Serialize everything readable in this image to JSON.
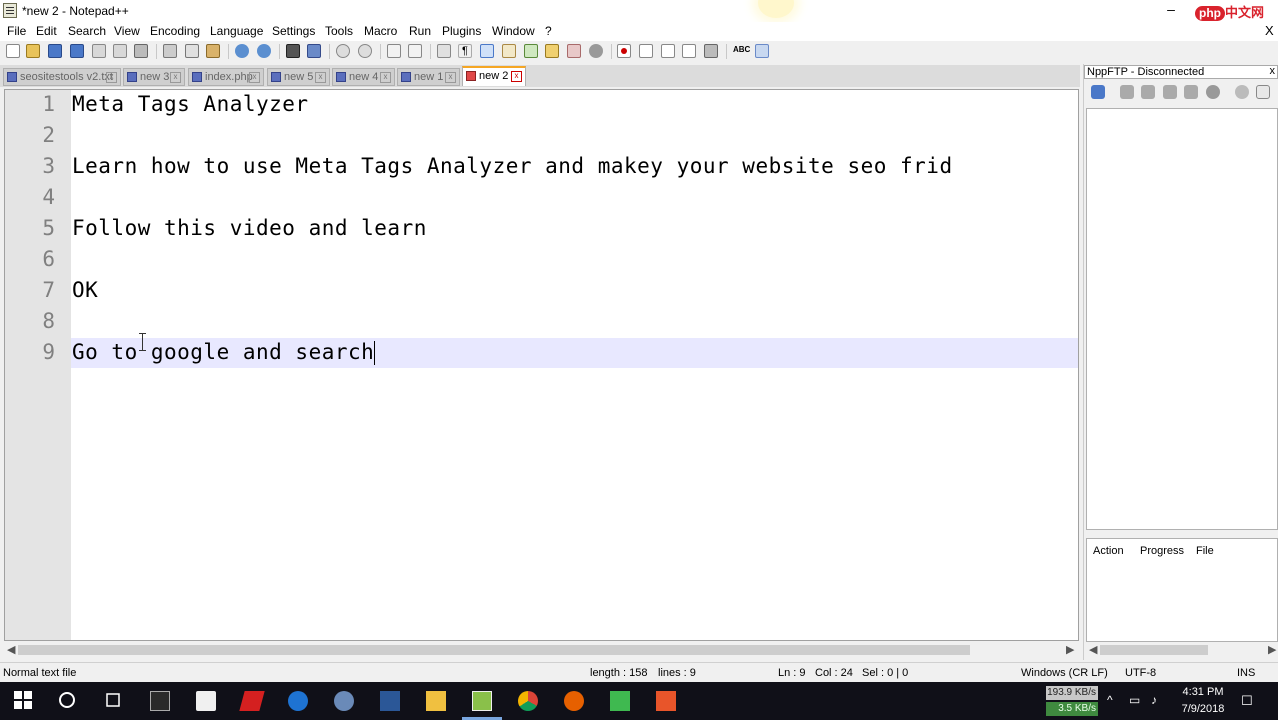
{
  "window": {
    "title": "*new 2 - Notepad++",
    "minimize_glyph": "–",
    "overlay_logo": {
      "badge": "php",
      "text": "中文网"
    }
  },
  "menu": {
    "items": [
      "File",
      "Edit",
      "Search",
      "View",
      "Encoding",
      "Language",
      "Settings",
      "Tools",
      "Macro",
      "Run",
      "Plugins",
      "Window",
      "?"
    ],
    "close_glyph": "X"
  },
  "toolbar": {
    "icons": [
      "new-file-icon",
      "open-icon",
      "save-icon",
      "save-all-icon",
      "close-icon",
      "close-all-icon",
      "print-icon",
      "cut-icon",
      "copy-icon",
      "paste-icon",
      "undo-icon",
      "redo-icon",
      "find-icon",
      "replace-icon",
      "zoom-in-icon",
      "zoom-out-icon",
      "sync-v-icon",
      "sync-h-icon",
      "word-wrap-icon",
      "show-all-chars-icon",
      "indent-guide-icon",
      "doc-map-icon",
      "function-list-icon",
      "folder-workspace-icon",
      "monitor-icon",
      "record-macro-icon",
      "stop-macro-icon",
      "play-macro-icon",
      "run-macro-multiple-icon",
      "save-macro-icon",
      "spellcheck-icon",
      "ftp-icon"
    ]
  },
  "tabs": [
    {
      "label": "seositestools v2.txt",
      "active": false
    },
    {
      "label": "new 3",
      "active": false
    },
    {
      "label": "index.php",
      "active": false
    },
    {
      "label": "new 5",
      "active": false
    },
    {
      "label": "new 4",
      "active": false
    },
    {
      "label": "new 1",
      "active": false
    },
    {
      "label": "new 2",
      "active": true
    }
  ],
  "editor": {
    "lines": [
      {
        "num": "1",
        "text": "Meta Tags Analyzer"
      },
      {
        "num": "2",
        "text": ""
      },
      {
        "num": "3",
        "text": "Learn how to use Meta Tags Analyzer and makey your website seo frid"
      },
      {
        "num": "4",
        "text": ""
      },
      {
        "num": "5",
        "text": "Follow this video and learn"
      },
      {
        "num": "6",
        "text": ""
      },
      {
        "num": "7",
        "text": "OK"
      },
      {
        "num": "8",
        "text": ""
      },
      {
        "num": "9",
        "text": "Go to google and search"
      }
    ],
    "current_line": 9
  },
  "ftp_panel": {
    "title": "NppFTP - Disconnected",
    "close_glyph": "x",
    "queue_columns": [
      "Action",
      "Progress",
      "File"
    ]
  },
  "statusbar": {
    "file_type": "Normal text file",
    "length": "length : 158",
    "lines": "lines : 9",
    "ln": "Ln : 9",
    "col": "Col : 24",
    "sel": "Sel : 0 | 0",
    "eol": "Windows (CR LF)",
    "encoding": "UTF-8",
    "mode": "INS"
  },
  "taskbar": {
    "net_down": "193.9 KB/s",
    "net_up": "3.5 KB/s",
    "time": "4:31 PM",
    "date": "7/9/2018",
    "apps": [
      "windows-start-icon",
      "cortana-icon",
      "task-view-icon",
      "calculator-icon",
      "store-icon",
      "app-red-icon",
      "edge-icon",
      "globe-icon",
      "word-icon",
      "file-explorer-icon",
      "notepadpp-icon",
      "chrome-icon",
      "firefox-icon",
      "camtasia-green-icon",
      "camtasia-orange-icon"
    ]
  }
}
